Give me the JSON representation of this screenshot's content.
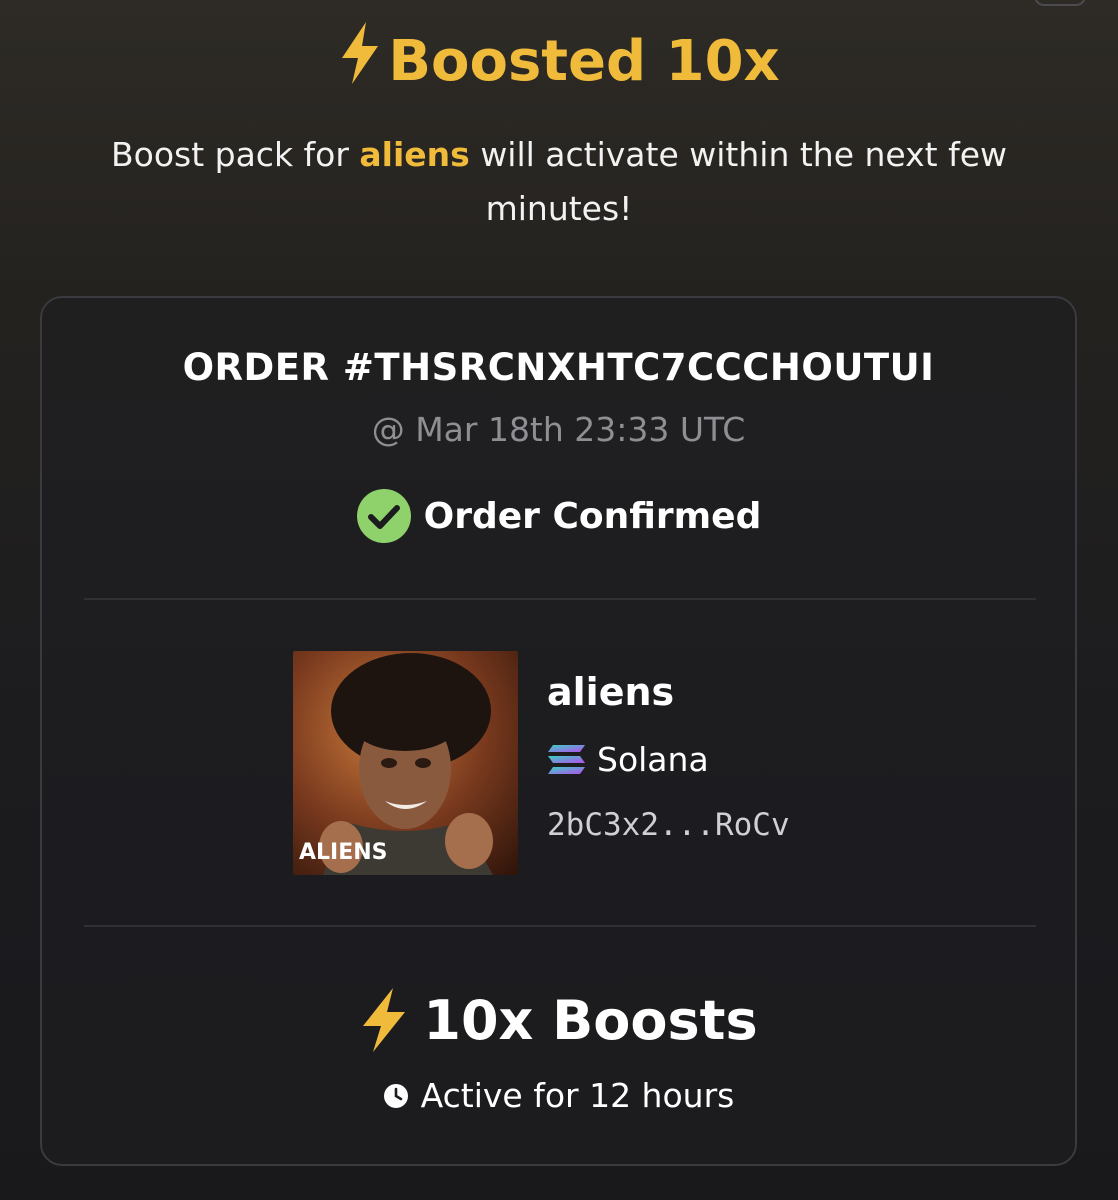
{
  "header": {
    "title": "Boosted 10x",
    "title_icon": "lightning-bolt-icon"
  },
  "message": {
    "prefix": "Boost pack for ",
    "token": "aliens",
    "suffix": " will activate within the next few minutes!"
  },
  "order": {
    "id_label": "ORDER #THSRCNXHTC7CCCHOUTUI",
    "timestamp": "@ Mar 18th 23:33 UTC",
    "status": "Order Confirmed",
    "status_icon": "check-circle-icon"
  },
  "token": {
    "name": "aliens",
    "chain": "Solana",
    "chain_icon": "solana-icon",
    "address": "2bC3x2...RoCv",
    "image_caption": "ALIENS"
  },
  "boost": {
    "label": "10x Boosts",
    "icon": "lightning-bolt-icon",
    "duration": "Active for 12 hours",
    "duration_icon": "clock-icon"
  },
  "colors": {
    "accent": "#f0bb3a",
    "success": "#8fd26b",
    "background": "#1c1c1f",
    "muted_text": "#8e8e93"
  }
}
